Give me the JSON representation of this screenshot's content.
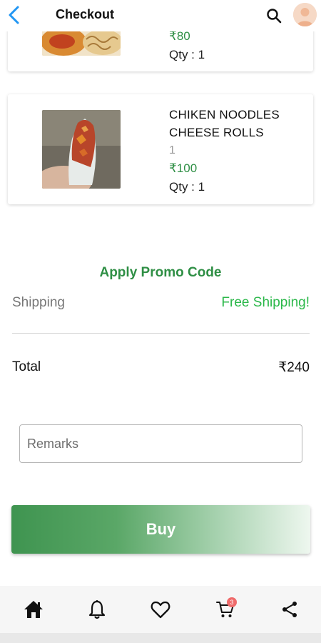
{
  "header": {
    "title": "Checkout",
    "back_icon": "chevron-left-icon",
    "search_icon": "search-icon",
    "accent_color": "#2196f3"
  },
  "cart_items": [
    {
      "price": "₹80",
      "qty": "Qty : 1"
    },
    {
      "name_line1": "CHIKEN NOODLES",
      "name_line2": "CHEESE ROLLS",
      "variant": "1",
      "price": "₹100",
      "qty": "Qty : 1"
    }
  ],
  "promo": {
    "label": "Apply Promo Code"
  },
  "shipping": {
    "label": "Shipping",
    "value": "Free Shipping!"
  },
  "total": {
    "label": "Total",
    "value": "₹240"
  },
  "remarks": {
    "placeholder": "Remarks"
  },
  "buy": {
    "label": "Buy"
  },
  "bottom_nav": {
    "items": [
      "home-icon",
      "bell-icon",
      "heart-icon",
      "cart-icon",
      "share-icon"
    ],
    "cart_badge": "3"
  },
  "colors": {
    "green": "#2f8f45",
    "free_shipping_green": "#2bb84a",
    "badge": "#ef6b6b"
  }
}
